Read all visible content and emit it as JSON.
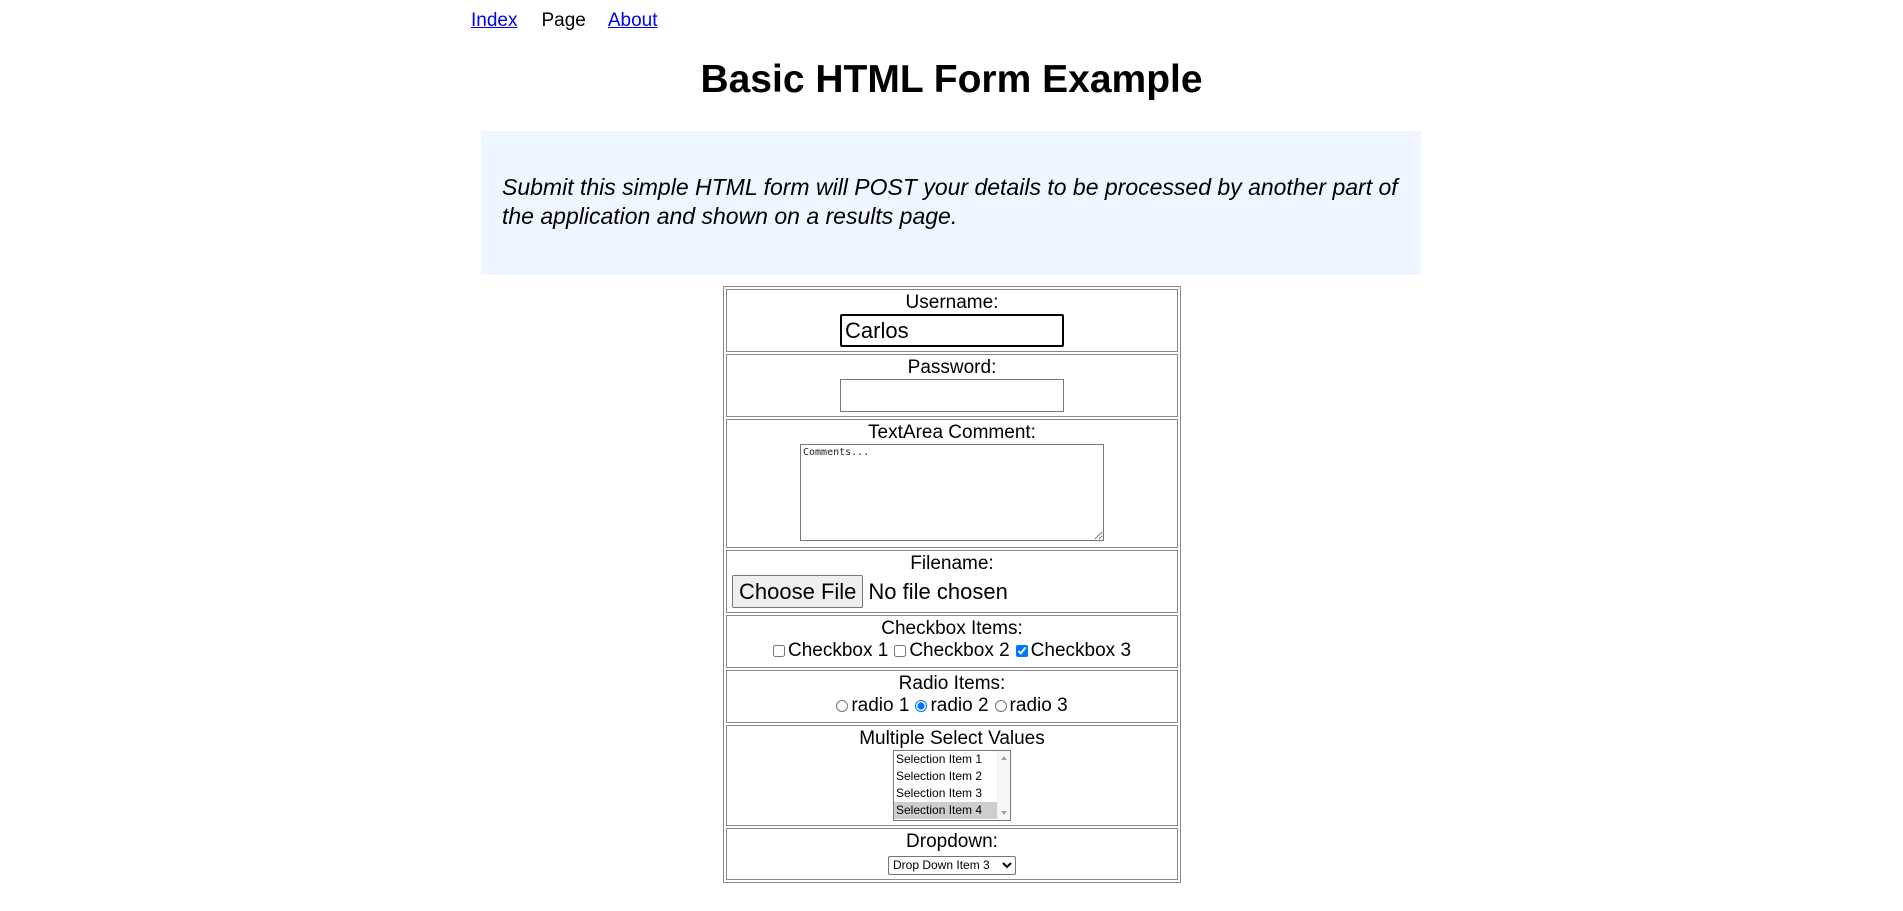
{
  "nav": {
    "index": "Index",
    "page": "Page",
    "about": "About"
  },
  "title": "Basic HTML Form Example",
  "explanation": "Submit this simple HTML form will POST your details to be processed by another part of the application and shown on a results page.",
  "form": {
    "username": {
      "label": "Username:",
      "value": "Carlos"
    },
    "password": {
      "label": "Password:",
      "value": ""
    },
    "comment": {
      "label": "TextArea Comment:",
      "placeholder": "Comments..."
    },
    "file": {
      "label": "Filename:",
      "button": "Choose File",
      "status": "No file chosen"
    },
    "checkboxes": {
      "label": "Checkbox Items:",
      "items": [
        {
          "label": "Checkbox 1",
          "checked": false
        },
        {
          "label": "Checkbox 2",
          "checked": false
        },
        {
          "label": "Checkbox 3",
          "checked": true
        }
      ]
    },
    "radios": {
      "label": "Radio Items:",
      "items": [
        {
          "label": "radio 1",
          "checked": false
        },
        {
          "label": "radio 2",
          "checked": true
        },
        {
          "label": "radio 3",
          "checked": false
        }
      ]
    },
    "multiselect": {
      "label": "Multiple Select Values",
      "options": [
        "Selection Item 1",
        "Selection Item 2",
        "Selection Item 3",
        "Selection Item 4"
      ],
      "selected": "Selection Item 4"
    },
    "dropdown": {
      "label": "Dropdown:",
      "selected": "Drop Down Item 3"
    }
  },
  "colors": {
    "link": "#0000ee",
    "explanation_bg": "#eef6ff",
    "selected_option_bg": "#cecece"
  }
}
